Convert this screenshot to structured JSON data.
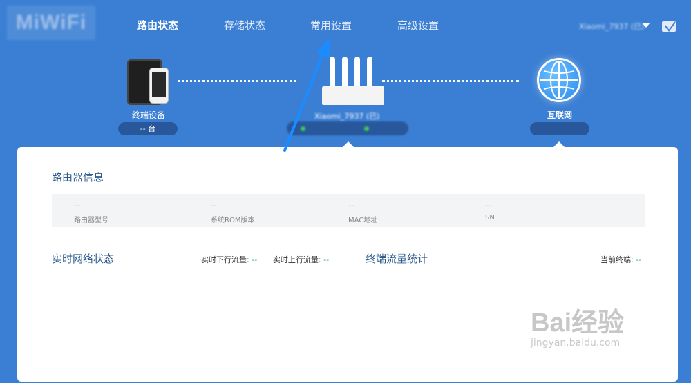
{
  "header": {
    "logo": "MiWiFi",
    "tabs": [
      {
        "label": "路由状态"
      },
      {
        "label": "存储状态"
      },
      {
        "label": "常用设置"
      },
      {
        "label": "高级设置"
      }
    ],
    "user_label": "Xiaomi_7937 (已)"
  },
  "topology": {
    "terminal_label": "终端设备",
    "terminal_count": "-- 台",
    "router_name": "Xiaomi_7937 (已)",
    "internet_label": "互联网"
  },
  "router_info": {
    "title": "路由器信息",
    "fields": [
      {
        "value": "--",
        "label": "路由器型号"
      },
      {
        "value": "--",
        "label": "系统ROM版本"
      },
      {
        "value": "--",
        "label": "MAC地址"
      },
      {
        "value": "--",
        "label": "SN"
      }
    ]
  },
  "network": {
    "title": "实时网络状态",
    "down_label": "实时下行流量:",
    "down_value": "--",
    "up_label": "实时上行流量:",
    "up_value": "--"
  },
  "traffic": {
    "title": "终端流量统计",
    "current_label": "当前终端:",
    "current_value": "--"
  },
  "watermark": {
    "logo": "Bai经验",
    "sub": "jingyan.baidu.com"
  },
  "colors": {
    "header_bg": "#3b7fd4",
    "active_tab": "#ffffff",
    "section_title": "#2c5b8e",
    "status_green": "#3ecb57",
    "annotation_arrow": "#1a8cff"
  }
}
